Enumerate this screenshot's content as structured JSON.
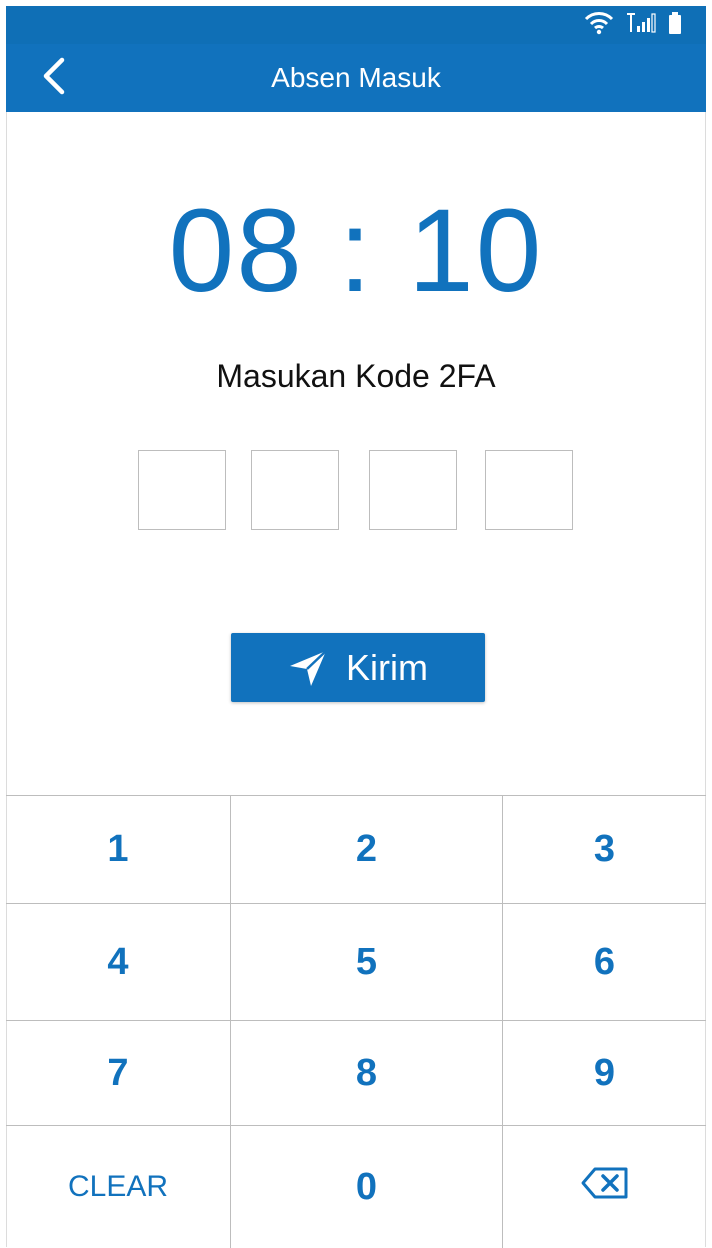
{
  "app": {
    "title": "Absen Masuk"
  },
  "clock": {
    "time": "08 : 10"
  },
  "prompt": {
    "text": "Masukan Kode 2FA"
  },
  "code_inputs": [
    "",
    "",
    "",
    ""
  ],
  "send_button": {
    "label": "Kirim",
    "icon": "send-icon"
  },
  "keypad": {
    "keys": [
      {
        "label": "1"
      },
      {
        "label": "2"
      },
      {
        "label": "3"
      },
      {
        "label": "4"
      },
      {
        "label": "5"
      },
      {
        "label": "6"
      },
      {
        "label": "7"
      },
      {
        "label": "8"
      },
      {
        "label": "9"
      },
      {
        "label": "CLEAR"
      },
      {
        "label": "0"
      },
      {
        "icon": "backspace-icon"
      }
    ]
  },
  "colors": {
    "primary": "#1172bd",
    "statusbar": "#0f6fb6",
    "text": "#111111"
  }
}
